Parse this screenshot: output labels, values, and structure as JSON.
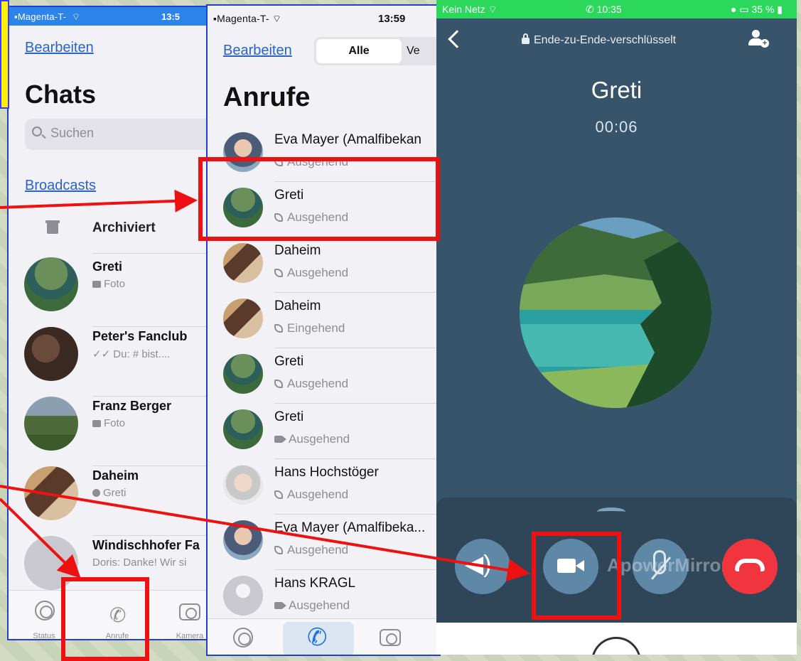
{
  "chats_screen": {
    "status": {
      "carrier": "Magenta-T-",
      "time": "13:5"
    },
    "edit_link": "Bearbeiten",
    "title": "Chats",
    "search_placeholder": "Suchen",
    "broadcasts_link": "Broadcasts",
    "archived_label": "Archiviert",
    "chats": [
      {
        "name": "Greti",
        "preview": "Foto",
        "icon": "camera-icon"
      },
      {
        "name": "Peter's Fanclub",
        "preview": "✓✓ Du: # bist....",
        "icon": "double-check-icon"
      },
      {
        "name": "Franz Berger",
        "preview": "Foto",
        "icon": "camera-icon"
      },
      {
        "name": "Daheim",
        "preview": "Greti",
        "icon": "person-icon"
      },
      {
        "name": "Windischhofer Fa",
        "preview": "Doris: Danke! Wir si",
        "icon": "none"
      }
    ],
    "tabs": [
      {
        "label": "Status",
        "icon": "status-icon"
      },
      {
        "label": "Anrufe",
        "icon": "phone-icon"
      },
      {
        "label": "Kamera",
        "icon": "camera-icon"
      }
    ]
  },
  "calls_screen": {
    "status": {
      "carrier": "Magenta-T-",
      "time": "13:59"
    },
    "edit_link": "Bearbeiten",
    "segments": [
      "Alle",
      "Ve"
    ],
    "title": "Anrufe",
    "calls": [
      {
        "name": "Eva Mayer (Amalfibekan",
        "type": "Ausgehend",
        "kind": "phone"
      },
      {
        "name": "Greti",
        "type": "Ausgehend",
        "kind": "phone"
      },
      {
        "name": "Daheim",
        "type": "Ausgehend",
        "kind": "phone"
      },
      {
        "name": "Daheim",
        "type": "Eingehend",
        "kind": "phone"
      },
      {
        "name": "Greti",
        "type": "Ausgehend",
        "kind": "phone"
      },
      {
        "name": "Greti",
        "type": "Ausgehend",
        "kind": "video"
      },
      {
        "name": "Hans Hochstöger",
        "type": "Ausgehend",
        "kind": "phone"
      },
      {
        "name": "Eva Mayer (Amalfibeka...",
        "type": "Ausgehend",
        "kind": "phone"
      },
      {
        "name": "Hans KRAGL",
        "type": "Ausgehend",
        "kind": "video"
      }
    ]
  },
  "call_screen": {
    "status": {
      "carrier": "Kein Netz",
      "time": "10:35",
      "battery": "35 %"
    },
    "encryption": "Ende-zu-Ende-verschlüsselt",
    "contact": "Greti",
    "duration": "00:06",
    "watermark": "ApowerMirror",
    "buttons": [
      "speaker-icon",
      "video-camera-icon",
      "mute-microphone-icon",
      "end-call-icon"
    ]
  },
  "colors": {
    "highlight": "#ee1111",
    "accent_blue": "#1a73e8",
    "call_bg": "#37546b",
    "end_call": "#f0353e"
  }
}
